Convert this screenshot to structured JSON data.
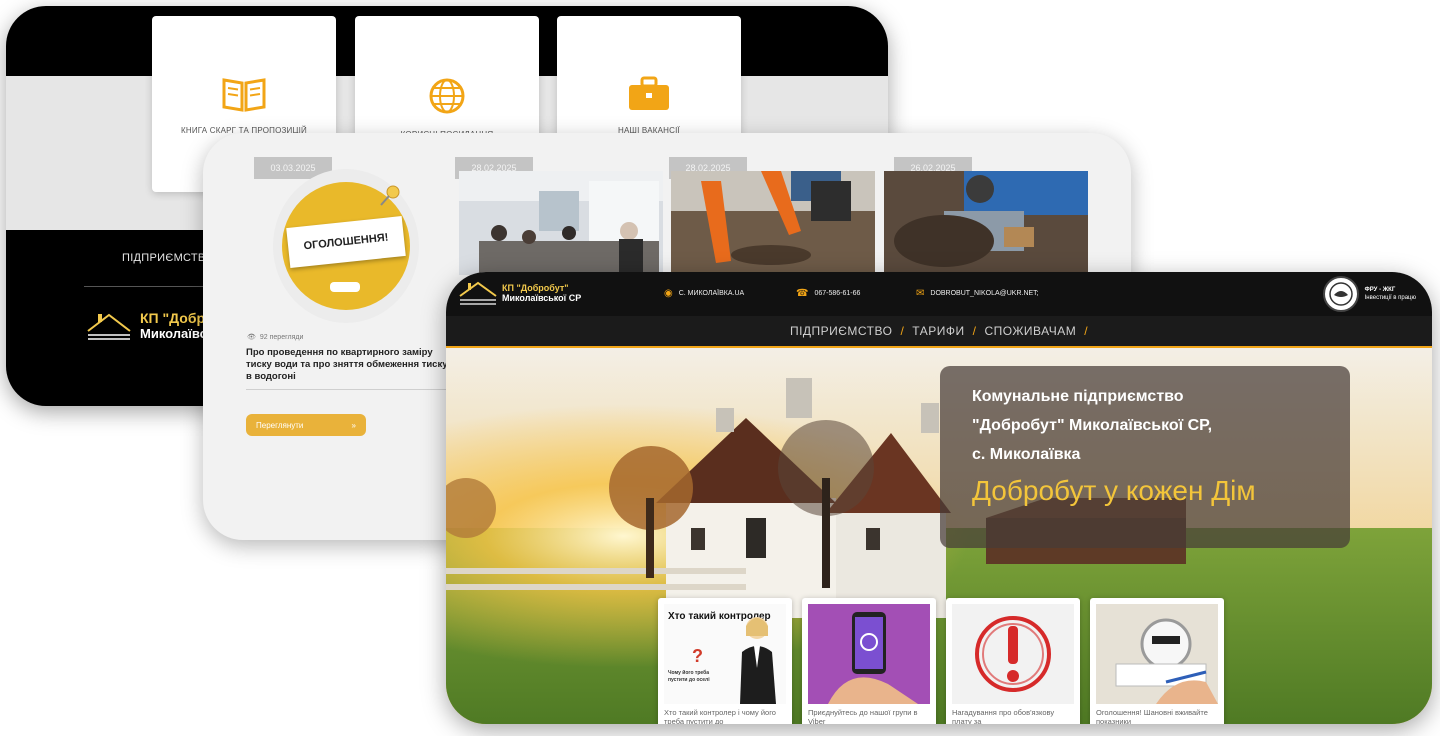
{
  "back_card": {
    "tiles": [
      {
        "label": "КНИГА СКАРГ ТА ПРОПОЗИЦІЙ",
        "icon": "book-icon"
      },
      {
        "label": "КОРИСНІ ПОСИЛАННЯ",
        "icon": "globe-icon"
      },
      {
        "label": "НАШІ ВАКАНСІЇ",
        "icon": "briefcase-icon"
      }
    ],
    "footer_label": "ПІДПРИЄМСТВО",
    "logo_line1": "КП \"Добробут\"",
    "logo_line2": "Миколаївської"
  },
  "news_card": {
    "dates": [
      "03.03.2025",
      "28.02.2025",
      "28.02.2025",
      "26.02.2025"
    ],
    "announcement_sign": "ОГОЛОШЕННЯ!",
    "views": "92 перегляди",
    "title": "Про проведення по квартирного заміру тиску води та про зняття обмеження тиску в водогоні",
    "more_button": "Переглянути",
    "more_button_icon": "arrow-icon"
  },
  "front_card": {
    "brand_line1": "КП \"Добробут\"",
    "brand_line2": "Миколаївської СР",
    "contacts": [
      {
        "icon": "location-icon",
        "text": "С. МИКОЛАЇВКА.UA"
      },
      {
        "icon": "phone-icon",
        "text": "067-586-61-66"
      },
      {
        "icon": "mail-icon",
        "text": "DOBROBUT_NIKOLA@UKR.NET;"
      }
    ],
    "fpu_title": "ФРУ - ЖКГ",
    "fpu_sub": "Інвестиції в працю",
    "nav": [
      "ПІДПРИЄМСТВО",
      "ТАРИФИ",
      "СПОЖИВАЧАМ"
    ],
    "nav_separator": "/",
    "hero": {
      "line1": "Комунальне підприємство",
      "line2": "\"Добробут\" Миколаївської СР,",
      "line3": "с. Миколаївка",
      "slogan": "Добробут у кожен Дім"
    },
    "news_tiles": [
      {
        "caption": "Хто такий контролер і чому його треба пустити до",
        "img_title": "Хто такий контролер",
        "img_q": "?",
        "img_sub": "Чому його треба пустити до оселі"
      },
      {
        "caption": "Приєднуйтесь до нашої групи в Viber"
      },
      {
        "caption": "Нагадування про обов'язкову плату за"
      },
      {
        "caption": "Оголошення! Шановні вживайте показники"
      }
    ]
  },
  "colors": {
    "accent": "#f2a516",
    "gold": "#e9b92a",
    "dark": "#111111"
  }
}
